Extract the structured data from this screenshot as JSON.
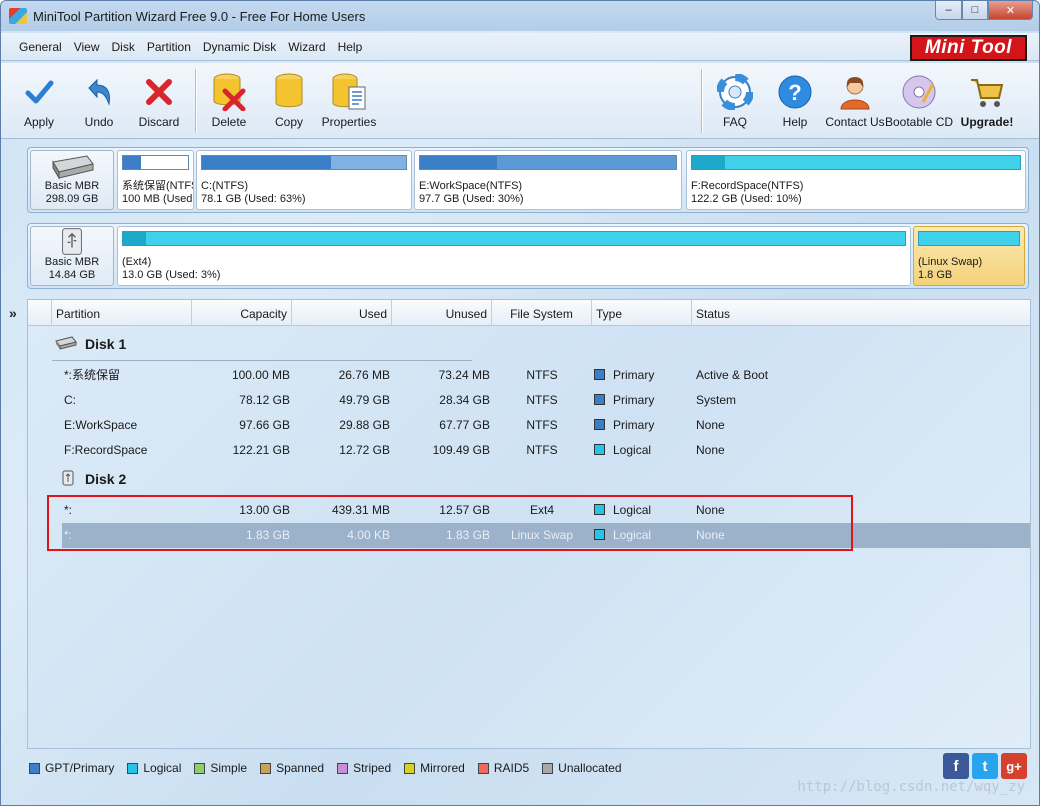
{
  "window": {
    "title": "MiniTool Partition Wizard Free 9.0 - Free For Home Users"
  },
  "winctl": {
    "min": "–",
    "max": "□",
    "close": "✕"
  },
  "menu": [
    "General",
    "View",
    "Disk",
    "Partition",
    "Dynamic Disk",
    "Wizard",
    "Help"
  ],
  "logo": "Mini Tool",
  "toolbar": {
    "apply": "Apply",
    "undo": "Undo",
    "discard": "Discard",
    "delete": "Delete",
    "copy": "Copy",
    "properties": "Properties",
    "faq": "FAQ",
    "help": "Help",
    "contact": "Contact Us",
    "bootable": "Bootable CD",
    "upgrade": "Upgrade!"
  },
  "diskmap": {
    "disk1": {
      "type": "Basic MBR",
      "size": "298.09 GB",
      "parts": [
        {
          "name": "系统保留(NTFS",
          "info": "100 MB (Used",
          "used_fraction": 0.27
        },
        {
          "name": "C:(NTFS)",
          "info": "78.1 GB (Used: 63%)",
          "used_fraction": 0.63
        },
        {
          "name": "E:WorkSpace(NTFS)",
          "info": "97.7 GB (Used: 30%)",
          "used_fraction": 0.3
        },
        {
          "name": "F:RecordSpace(NTFS)",
          "info": "122.2 GB (Used: 10%)",
          "used_fraction": 0.1
        }
      ]
    },
    "disk2": {
      "type": "Basic MBR",
      "size": "14.84 GB",
      "parts": [
        {
          "name": "(Ext4)",
          "info": "13.0 GB (Used: 3%)",
          "used_fraction": 0.03
        },
        {
          "name": "(Linux Swap)",
          "info": "1.8 GB",
          "used_fraction": 0
        }
      ]
    }
  },
  "table": {
    "headers": [
      "Partition",
      "Capacity",
      "Used",
      "Unused",
      "File System",
      "Type",
      "Status"
    ],
    "disk1_label": "Disk 1",
    "disk2_label": "Disk 2",
    "disk1_rows": [
      [
        "*:系统保留",
        "100.00 MB",
        "26.76 MB",
        "73.24 MB",
        "NTFS",
        "Primary",
        "Active & Boot"
      ],
      [
        "C:",
        "78.12 GB",
        "49.79 GB",
        "28.34 GB",
        "NTFS",
        "Primary",
        "System"
      ],
      [
        "E:WorkSpace",
        "97.66 GB",
        "29.88 GB",
        "67.77 GB",
        "NTFS",
        "Primary",
        "None"
      ],
      [
        "F:RecordSpace",
        "122.21 GB",
        "12.72 GB",
        "109.49 GB",
        "NTFS",
        "Logical",
        "None"
      ]
    ],
    "disk2_rows": [
      [
        "*:",
        "13.00 GB",
        "439.31 MB",
        "12.57 GB",
        "Ext4",
        "Logical",
        "None"
      ],
      [
        "*:",
        "1.83 GB",
        "4.00 KB",
        "1.83 GB",
        "Linux Swap",
        "Logical",
        "None"
      ]
    ]
  },
  "legend": [
    "GPT/Primary",
    "Logical",
    "Simple",
    "Spanned",
    "Striped",
    "Mirrored",
    "RAID5",
    "Unallocated"
  ],
  "legend_colors": [
    "#3a7fc8",
    "#28c4e8",
    "#8dcf6b",
    "#c9a25a",
    "#c98fd6",
    "#d9d11c",
    "#ef6a5e",
    "#a8a8a8"
  ],
  "social": [
    "f",
    "t",
    "g+"
  ],
  "watermark": "http://blog.csdn.net/wqy_zy"
}
